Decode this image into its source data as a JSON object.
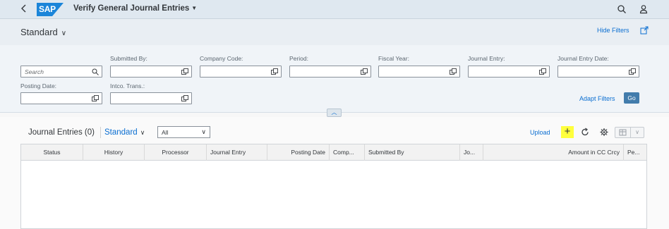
{
  "shell": {
    "logo_text": "SAP",
    "app_title": "Verify General Journal Entries",
    "back_icon": "chevron-left-icon",
    "search_icon": "search-icon",
    "user_icon": "user-icon"
  },
  "header": {
    "variant_label": "Standard",
    "hide_filters_label": "Hide Filters",
    "share_icon": "share-icon"
  },
  "filters": {
    "search_placeholder": "Search",
    "fields": [
      {
        "label": "Submitted By:",
        "value": ""
      },
      {
        "label": "Company Code:",
        "value": ""
      },
      {
        "label": "Period:",
        "value": ""
      },
      {
        "label": "Fiscal Year:",
        "value": ""
      },
      {
        "label": "Journal Entry:",
        "value": ""
      },
      {
        "label": "Journal Entry Date:",
        "value": ""
      },
      {
        "label": "Posting Date:",
        "value": ""
      },
      {
        "label": "Intco. Trans.:",
        "value": ""
      }
    ],
    "adapt_filters_label": "Adapt Filters",
    "go_label": "Go"
  },
  "table": {
    "title": "Journal Entries (0)",
    "variant_label": "Standard",
    "select_value": "All",
    "upload_label": "Upload",
    "columns": [
      "Status",
      "History",
      "Processor",
      "Journal Entry",
      "Posting Date",
      "Comp...",
      "Submitted By",
      "Jo...",
      "Amount in CC Crcy",
      "Pe..."
    ]
  },
  "colors": {
    "shell_bg": "#dfe8f0",
    "accent": "#0a6ed1",
    "go_button": "#427cac",
    "highlight": "#ffff3c"
  }
}
